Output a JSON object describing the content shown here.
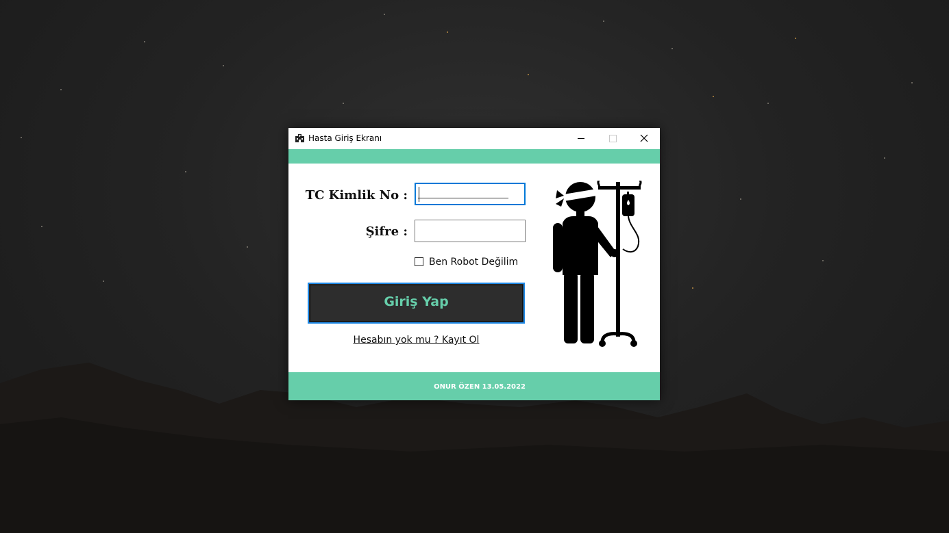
{
  "window": {
    "title": "Hasta Giriş Ekranı"
  },
  "form": {
    "tc_label": "TC Kimlik No :",
    "tc_value": "___________",
    "password_label": "Şifre :",
    "password_value": "",
    "robot_check_label": "Ben Robot Değilim",
    "robot_checked": false,
    "login_button_label": "Giriş Yap",
    "register_link_label": "Hesabın yok mu ? Kayıt Ol"
  },
  "footer": {
    "text": "ONUR ÖZEN 13.05.2022"
  },
  "icons": {
    "app": "hospital-icon",
    "illustration": "patient-with-iv-drip-icon",
    "minimize": "minimize-icon",
    "maximize": "maximize-icon",
    "close": "close-icon"
  },
  "colors": {
    "accent": "#66ceaa",
    "button_bg": "#2d2d2d",
    "focus_border": "#0078d7"
  }
}
